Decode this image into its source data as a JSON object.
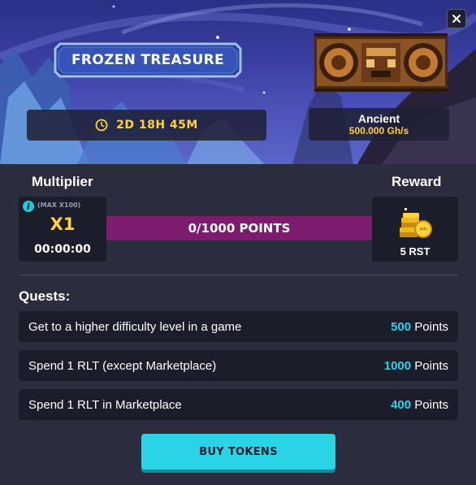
{
  "event": {
    "title": "FROZEN TREASURE",
    "timer": "2D 18H 45M",
    "miner_name": "Ancient",
    "miner_power": "500.000 Gh/s"
  },
  "progress": {
    "multiplier_title": "Multiplier",
    "reward_title": "Reward",
    "max_label": "(MAX X100)",
    "multiplier_value": "X1",
    "multiplier_time": "00:00:00",
    "points_text": "0/1000 POINTS",
    "points_fraction": 0,
    "reward_amount": "5 RST"
  },
  "quests": {
    "title": "Quests:",
    "points_suffix": "Points",
    "items": [
      {
        "label": "Get to a higher difficulty level in a game",
        "points": "500"
      },
      {
        "label": "Spend 1 RLT (except Marketplace)",
        "points": "1000"
      },
      {
        "label": "Spend 1 RLT in Marketplace",
        "points": "400"
      }
    ]
  },
  "actions": {
    "buy_label": "BUY TOKENS"
  },
  "colors": {
    "accent_cyan": "#2ad3e6",
    "gold": "#ffd23a",
    "progress_track": "#7d1c6f",
    "panel": "#1c1d2b",
    "background": "#2b2c3e"
  },
  "icons": {
    "close": "close-icon",
    "clock": "clock-icon",
    "info": "info-icon",
    "reward": "coin-stack-icon"
  }
}
